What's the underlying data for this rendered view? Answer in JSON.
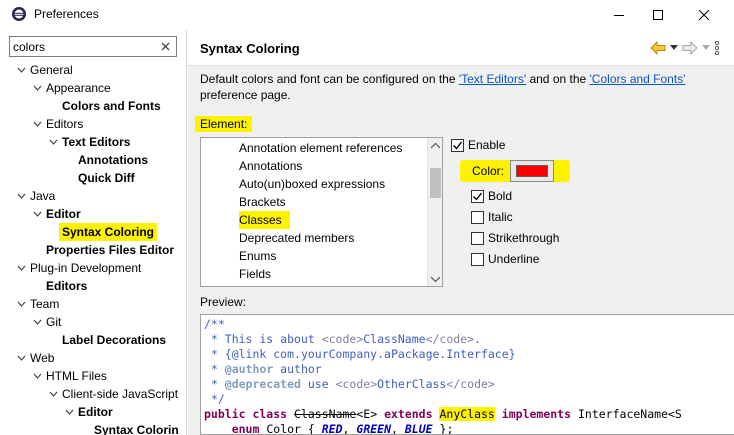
{
  "window": {
    "title": "Preferences",
    "icon": "eclipse-icon"
  },
  "filter": {
    "value": "colors"
  },
  "tree": [
    {
      "label": "General",
      "level": 0,
      "expanded": true,
      "bold": false
    },
    {
      "label": "Appearance",
      "level": 1,
      "expanded": true,
      "bold": false
    },
    {
      "label": "Colors and Fonts",
      "level": 2,
      "expanded": null,
      "bold": true
    },
    {
      "label": "Editors",
      "level": 1,
      "expanded": true,
      "bold": false
    },
    {
      "label": "Text Editors",
      "level": 2,
      "expanded": true,
      "bold": true
    },
    {
      "label": "Annotations",
      "level": 3,
      "expanded": null,
      "bold": true
    },
    {
      "label": "Quick Diff",
      "level": 3,
      "expanded": null,
      "bold": true
    },
    {
      "label": "Java",
      "level": 0,
      "expanded": true,
      "bold": false
    },
    {
      "label": "Editor",
      "level": 1,
      "expanded": true,
      "bold": true
    },
    {
      "label": "Syntax Coloring",
      "level": 2,
      "expanded": null,
      "bold": true,
      "selected": true
    },
    {
      "label": "Properties Files Editor",
      "level": 1,
      "expanded": null,
      "bold": true
    },
    {
      "label": "Plug-in Development",
      "level": 0,
      "expanded": true,
      "bold": false
    },
    {
      "label": "Editors",
      "level": 1,
      "expanded": null,
      "bold": true
    },
    {
      "label": "Team",
      "level": 0,
      "expanded": true,
      "bold": false
    },
    {
      "label": "Git",
      "level": 1,
      "expanded": true,
      "bold": false
    },
    {
      "label": "Label Decorations",
      "level": 2,
      "expanded": null,
      "bold": true
    },
    {
      "label": "Web",
      "level": 0,
      "expanded": true,
      "bold": false
    },
    {
      "label": "HTML Files",
      "level": 1,
      "expanded": true,
      "bold": false
    },
    {
      "label": "Client-side JavaScript",
      "level": 2,
      "expanded": true,
      "bold": false
    },
    {
      "label": "Editor",
      "level": 3,
      "expanded": true,
      "bold": true
    },
    {
      "label": "Syntax Colorin",
      "level": 4,
      "expanded": null,
      "bold": true
    }
  ],
  "page": {
    "title": "Syntax Coloring",
    "description_prefix": "Default colors and font can be configured on the ",
    "link_text_editors": "'Text Editors'",
    "description_middle": " and on the ",
    "link_colors_fonts": "'Colors and Fonts'",
    "description_suffix": " preference page.",
    "element_label": "Element:",
    "elements": [
      "Annotation element references",
      "Annotations",
      "Auto(un)boxed expressions",
      "Brackets",
      "Classes",
      "Deprecated members",
      "Enums",
      "Fields"
    ],
    "selected_element": "Classes",
    "enable_label": "Enable",
    "enable_checked": true,
    "color_label": "Color:",
    "color_value": "#ff0000",
    "bold_label": "Bold",
    "bold_checked": true,
    "italic_label": "Italic",
    "italic_checked": false,
    "strike_label": "Strikethrough",
    "strike_checked": false,
    "underline_label": "Underline",
    "underline_checked": false,
    "preview_label": "Preview:"
  },
  "preview": {
    "l1": "/**",
    "l2a": " * This is about ",
    "l2b": "<code>",
    "l2c": "ClassName",
    "l2d": "</code>",
    "l2e": ".",
    "l3a": " * ",
    "l3b": "{@link com.yourCompany.aPackage.Interface}",
    "l4a": " * ",
    "l4b": "@author",
    "l4c": " author",
    "l5a": " * ",
    "l5b": "@deprecated",
    "l5c": " use ",
    "l5d": "<code>",
    "l5e": "OtherClass",
    "l5f": "</code>",
    "l6": " */",
    "l7a": "public class",
    "l7b": "ClassName",
    "l7c": "<E>",
    "l7d": "extends",
    "l7e": "AnyClass",
    "l7f": "implements",
    "l7g": "InterfaceName<S",
    "l8a": "enum",
    "l8b": "Color {",
    "l8c": "RED",
    "l8d": "GREEN",
    "l8e": "BLUE",
    "l8f": "};"
  }
}
